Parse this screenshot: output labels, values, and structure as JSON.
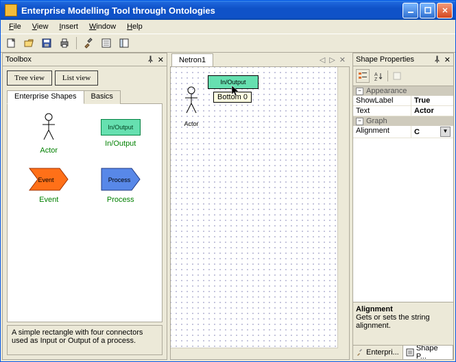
{
  "title": "Enterprise Modelling Tool through Ontologies",
  "menu": {
    "file": "File",
    "view": "View",
    "insert": "Insert",
    "window": "Window",
    "help": "Help"
  },
  "toolbox": {
    "title": "Toolbox",
    "tree_view": "Tree view",
    "list_view": "List view",
    "tabs": {
      "enterprise": "Enterprise Shapes",
      "basics": "Basics"
    },
    "shapes": {
      "actor": "Actor",
      "io": "In/Output",
      "event": "Event",
      "process": "Process"
    },
    "io_mini": "In/Output",
    "event_mini": "Event",
    "process_mini": "Process",
    "desc": "A simple rectangle with four connectors used as Input or Output of a process."
  },
  "canvas": {
    "tab": "Netron1",
    "io_label": "In/Output",
    "actor_label": "Actor",
    "tooltip": "Bottom 0"
  },
  "props": {
    "title": "Shape Properties",
    "cat_appearance": "Appearance",
    "show_label": "ShowLabel",
    "show_label_val": "True",
    "text": "Text",
    "text_val": "Actor",
    "cat_graph": "Graph",
    "alignment": "Alignment",
    "alignment_val": "C",
    "desc_title": "Alignment",
    "desc_body": "Gets or sets the string alignment."
  },
  "bottom_tabs": {
    "enterprise": "Enterpri...",
    "shape": "Shape P..."
  }
}
